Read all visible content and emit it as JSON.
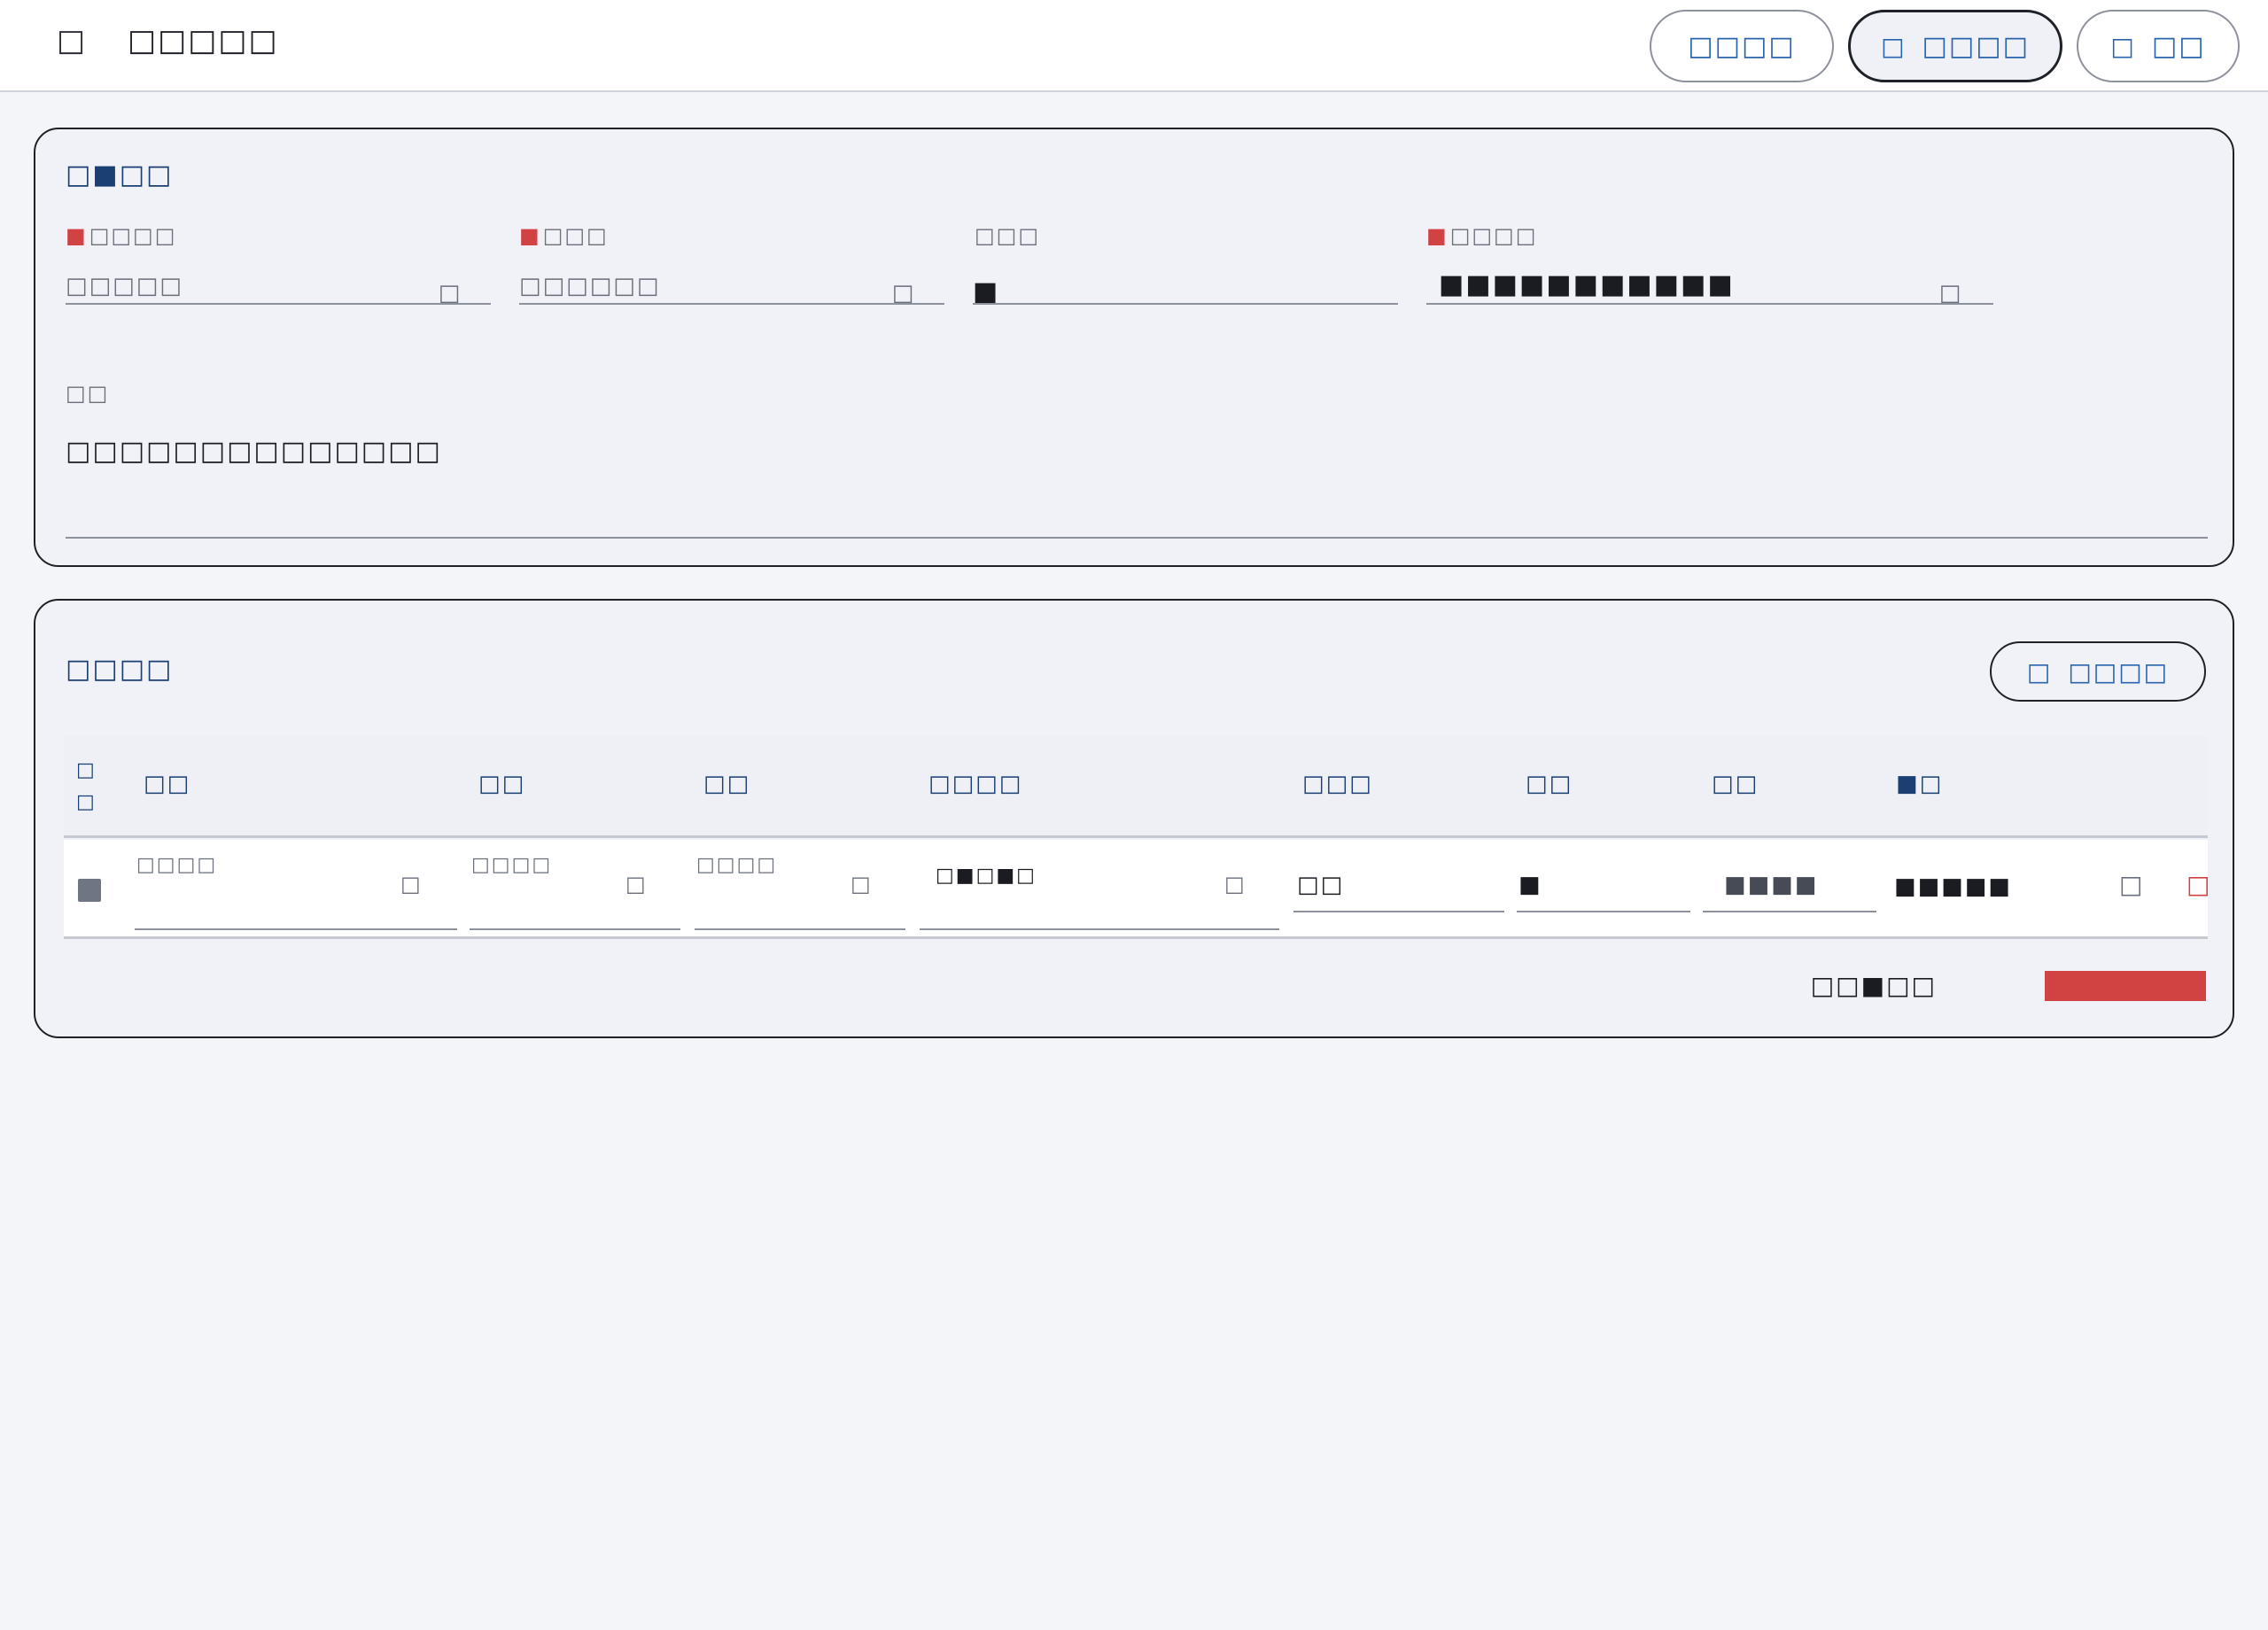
{
  "header": {
    "title": "□□□□□",
    "buttons": [
      {
        "label": "□□□□",
        "icon": ""
      },
      {
        "label": "□□□□",
        "icon": "□"
      },
      {
        "label": "□□",
        "icon": "□"
      }
    ]
  },
  "form": {
    "section_title": "□■□□",
    "fields": [
      {
        "label": "□□□□",
        "required": "■",
        "placeholder": "□□□□□",
        "icon": "□"
      },
      {
        "label": "□□□",
        "required": "■",
        "placeholder": "□□□□□□",
        "icon": "□"
      },
      {
        "label": "□□□",
        "required": "",
        "value": "■"
      },
      {
        "label": "□□□□",
        "required": "■",
        "value": "■■■■■■■■■■■",
        "icon": "□"
      }
    ],
    "note_label": "□□",
    "note_value": "□□□□□□□□□□□□□□"
  },
  "table": {
    "section_title": "□□□□",
    "add_button": {
      "icon": "□",
      "label": "□□□□"
    },
    "select_all_label": "□ □",
    "columns": [
      "□□",
      "□□",
      "□□",
      "□□□□",
      "□□□",
      "□□",
      "□□",
      "■□"
    ],
    "rows": [
      {
        "cells": [
          {
            "placeholder": "□□□□",
            "icon": "□"
          },
          {
            "placeholder": "□□□□",
            "icon": "□"
          },
          {
            "placeholder": "□□□□",
            "icon": "□"
          },
          {
            "value": "□■□■□",
            "icon": "□"
          },
          {
            "value": "□□"
          },
          {
            "value": "■"
          },
          {
            "value": "■■■■"
          },
          {
            "value": "■■■■■"
          }
        ],
        "actions": [
          {
            "icon": "□",
            "color": "#6a6f7b"
          },
          {
            "icon": "□",
            "color": "#d14343"
          }
        ]
      }
    ],
    "total_label": "□□■□□"
  },
  "colors": {
    "accent": "#2a64ad",
    "title_blue": "#1a3f73",
    "danger": "#d14343"
  }
}
